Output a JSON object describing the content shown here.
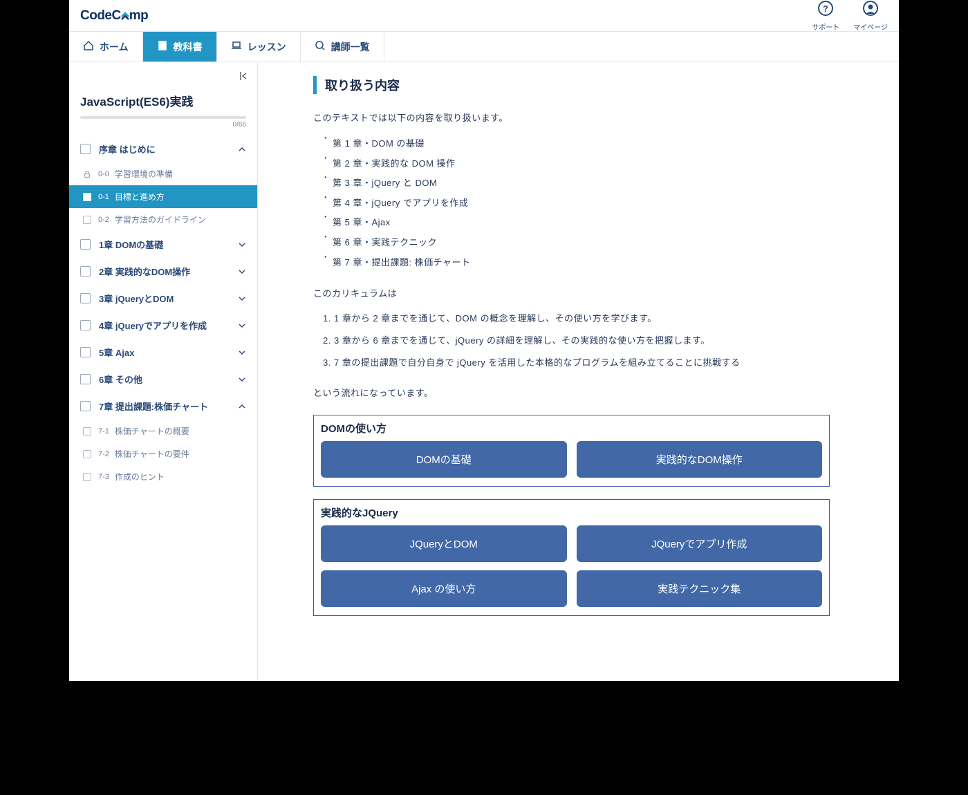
{
  "brand": {
    "prefix": "CodeC",
    "suffix": "mp"
  },
  "header_buttons": [
    {
      "label": "サポート"
    },
    {
      "label": "マイページ"
    }
  ],
  "tabs": [
    {
      "label": "ホーム"
    },
    {
      "label": "教科書"
    },
    {
      "label": "レッスン"
    },
    {
      "label": "講師一覧"
    }
  ],
  "sidebar": {
    "course_title": "JavaScript(ES6)実践",
    "progress": "0/66",
    "chapters": [
      {
        "title": "序章  はじめに",
        "expanded": true,
        "items": [
          {
            "code": "0-0",
            "title": "学習環境の準備",
            "locked": true
          },
          {
            "code": "0-1",
            "title": "目標と進め方",
            "active": true
          },
          {
            "code": "0-2",
            "title": "学習方法のガイドライン"
          }
        ]
      },
      {
        "title": "1章  DOMの基礎",
        "expanded": false
      },
      {
        "title": "2章  実践的なDOM操作",
        "expanded": false
      },
      {
        "title": "3章  jQueryとDOM",
        "expanded": false
      },
      {
        "title": "4章  jQueryでアプリを作成",
        "expanded": false
      },
      {
        "title": "5章  Ajax",
        "expanded": false
      },
      {
        "title": "6章  その他",
        "expanded": false
      },
      {
        "title": "7章  提出課題:株価チャート",
        "expanded": true,
        "items": [
          {
            "code": "7-1",
            "title": "株価チャートの概要"
          },
          {
            "code": "7-2",
            "title": "株価チャートの要件"
          },
          {
            "code": "7-3",
            "title": "作成のヒント"
          }
        ]
      }
    ]
  },
  "content": {
    "title": "取り扱う内容",
    "intro": "このテキストでは以下の内容を取り扱います。",
    "bullets": [
      "第 1 章・DOM の基礎",
      "第 2 章・実践的な DOM 操作",
      "第 3 章・jQuery と DOM",
      "第 4 章・jQuery でアプリを作成",
      "第 5 章・Ajax",
      "第 6 章・実践テクニック",
      "第 7 章・提出課題: 株価チャート"
    ],
    "lead2": "このカリキュラムは",
    "ordered": [
      "1 章から 2 章までを通じて、DOM の概念を理解し、その使い方を学びます。",
      "3 章から 6 章までを通じて、jQuery の詳細を理解し、その実践的な使い方を把握します。",
      "7 章の提出課題で自分自身で jQuery を活用した本格的なプログラムを組み立てることに挑戦する"
    ],
    "outro": "という流れになっています。",
    "groups": [
      {
        "title": "DOMの使い方",
        "rows": [
          [
            "DOMの基礎",
            "実践的なDOM操作"
          ]
        ]
      },
      {
        "title": "実践的なJQuery",
        "rows": [
          [
            "JQueryとDOM",
            "JQueryでアプリ作成"
          ],
          [
            "Ajax の使い方",
            "実践テクニック集"
          ]
        ]
      }
    ]
  }
}
